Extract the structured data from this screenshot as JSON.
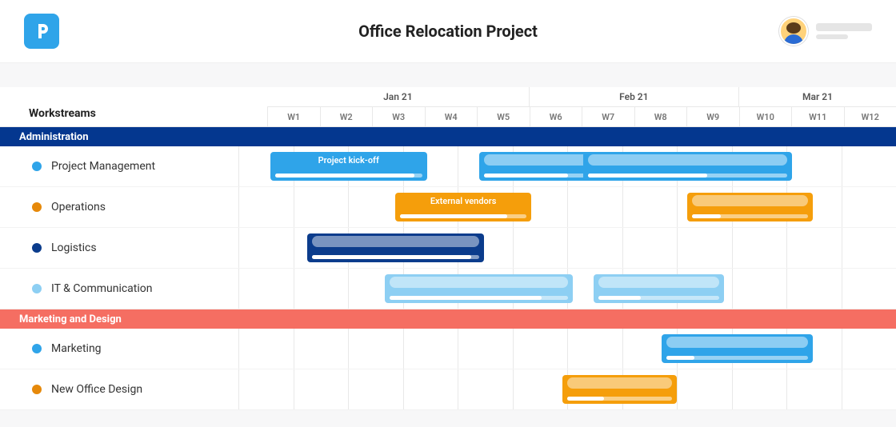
{
  "header": {
    "title": "Office Relocation Project"
  },
  "left_header": "Workstreams",
  "months": [
    {
      "label": "Jan 21",
      "span": 5
    },
    {
      "label": "Feb 21",
      "span": 4
    },
    {
      "label": "Mar 21",
      "span": 3
    }
  ],
  "weeks": [
    "W1",
    "W2",
    "W3",
    "W4",
    "W5",
    "W6",
    "W7",
    "W8",
    "W9",
    "W10",
    "W11",
    "W12"
  ],
  "groups": [
    {
      "id": "admin",
      "name": "Administration",
      "color": "admin",
      "rows": [
        {
          "name": "Project Management",
          "dot": "blue",
          "bars": [
            {
              "label": "Project kick-off",
              "start": 1,
              "end": 3,
              "color": "blue",
              "progress": 95
            },
            {
              "label": "",
              "start": 5,
              "end": 6.5,
              "color": "blue",
              "progress": 70
            },
            {
              "label": "",
              "start": 7,
              "end": 10,
              "color": "blue",
              "progress": 60
            }
          ]
        },
        {
          "name": "Operations",
          "dot": "orange",
          "bars": [
            {
              "label": "External vendors",
              "start": 3.4,
              "end": 5,
              "color": "orange",
              "progress": 85
            },
            {
              "label": "",
              "start": 9,
              "end": 10.4,
              "color": "orange",
              "progress": 25
            }
          ]
        },
        {
          "name": "Logistics",
          "dot": "navy",
          "bars": [
            {
              "label": "",
              "start": 1.7,
              "end": 4.1,
              "color": "navy",
              "progress": 95
            }
          ]
        },
        {
          "name": "IT & Communication",
          "dot": "light",
          "bars": [
            {
              "label": "",
              "start": 3.2,
              "end": 5.8,
              "color": "light",
              "progress": 85
            },
            {
              "label": "",
              "start": 7.2,
              "end": 8.7,
              "color": "light",
              "progress": 35
            }
          ]
        }
      ]
    },
    {
      "id": "mkt",
      "name": "Marketing and Design",
      "color": "mkt",
      "rows": [
        {
          "name": "Marketing",
          "dot": "blue",
          "bars": [
            {
              "label": "",
              "start": 8.5,
              "end": 10.4,
              "color": "blue",
              "progress": 20
            }
          ]
        },
        {
          "name": "New Office Design",
          "dot": "orange",
          "bars": [
            {
              "label": "",
              "start": 6.6,
              "end": 7.8,
              "color": "orange",
              "progress": 35
            }
          ]
        }
      ]
    }
  ],
  "chart_data": {
    "type": "gantt",
    "title": "Office Relocation Project",
    "x_unit": "week",
    "x_range": [
      1,
      12
    ],
    "x_labels": [
      "W1",
      "W2",
      "W3",
      "W4",
      "W5",
      "W6",
      "W7",
      "W8",
      "W9",
      "W10",
      "W11",
      "W12"
    ],
    "month_bands": [
      {
        "label": "Jan 21",
        "weeks": [
          1,
          2,
          3,
          4,
          5
        ]
      },
      {
        "label": "Feb 21",
        "weeks": [
          6,
          7,
          8,
          9
        ]
      },
      {
        "label": "Mar 21",
        "weeks": [
          10,
          11,
          12
        ]
      }
    ],
    "groups": [
      {
        "name": "Administration",
        "tasks": [
          {
            "workstream": "Project Management",
            "name": "Project kick-off",
            "start_week": 1,
            "end_week": 3,
            "progress_pct": 95,
            "color": "#2fa4e9"
          },
          {
            "workstream": "Project Management",
            "name": "(unnamed)",
            "start_week": 5,
            "end_week": 6.5,
            "progress_pct": 70,
            "color": "#2fa4e9"
          },
          {
            "workstream": "Project Management",
            "name": "(unnamed)",
            "start_week": 7,
            "end_week": 10,
            "progress_pct": 60,
            "color": "#2fa4e9"
          },
          {
            "workstream": "Operations",
            "name": "External vendors",
            "start_week": 3.4,
            "end_week": 5,
            "progress_pct": 85,
            "color": "#f59e0b"
          },
          {
            "workstream": "Operations",
            "name": "(unnamed)",
            "start_week": 9,
            "end_week": 10.4,
            "progress_pct": 25,
            "color": "#f59e0b"
          },
          {
            "workstream": "Logistics",
            "name": "(unnamed)",
            "start_week": 1.7,
            "end_week": 4.1,
            "progress_pct": 95,
            "color": "#0b3c8c"
          },
          {
            "workstream": "IT & Communication",
            "name": "(unnamed)",
            "start_week": 3.2,
            "end_week": 5.8,
            "progress_pct": 85,
            "color": "#8dcff3"
          },
          {
            "workstream": "IT & Communication",
            "name": "(unnamed)",
            "start_week": 7.2,
            "end_week": 8.7,
            "progress_pct": 35,
            "color": "#8dcff3"
          }
        ]
      },
      {
        "name": "Marketing and Design",
        "tasks": [
          {
            "workstream": "Marketing",
            "name": "(unnamed)",
            "start_week": 8.5,
            "end_week": 10.4,
            "progress_pct": 20,
            "color": "#2fa4e9"
          },
          {
            "workstream": "New Office Design",
            "name": "(unnamed)",
            "start_week": 6.6,
            "end_week": 7.8,
            "progress_pct": 35,
            "color": "#f59e0b"
          }
        ]
      }
    ]
  }
}
